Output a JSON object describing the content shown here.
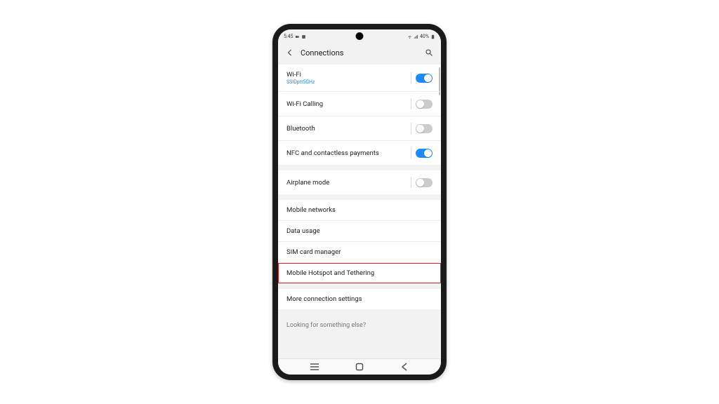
{
  "statusbar": {
    "time": "5:45",
    "battery": "40%"
  },
  "header": {
    "title": "Connections"
  },
  "groups": [
    {
      "items": [
        {
          "label": "Wi-Fi",
          "sub": "SSIDptt5GHz",
          "toggle": true,
          "on": true,
          "name": "row-wifi",
          "tname": "toggle-wifi"
        },
        {
          "label": "Wi-Fi Calling",
          "toggle": true,
          "on": false,
          "name": "row-wifi-calling",
          "tname": "toggle-wifi-calling"
        },
        {
          "label": "Bluetooth",
          "toggle": true,
          "on": false,
          "name": "row-bluetooth",
          "tname": "toggle-bluetooth"
        },
        {
          "label": "NFC and contactless payments",
          "toggle": true,
          "on": true,
          "name": "row-nfc",
          "tname": "toggle-nfc"
        }
      ]
    },
    {
      "items": [
        {
          "label": "Airplane mode",
          "toggle": true,
          "on": false,
          "name": "row-airplane",
          "tname": "toggle-airplane"
        }
      ]
    },
    {
      "items": [
        {
          "label": "Mobile networks",
          "name": "row-mobile-networks"
        },
        {
          "label": "Data usage",
          "name": "row-data-usage"
        },
        {
          "label": "SIM card manager",
          "name": "row-sim-manager"
        },
        {
          "label": "Mobile Hotspot and Tethering",
          "highlight": true,
          "name": "row-hotspot-tethering"
        }
      ]
    },
    {
      "items": [
        {
          "label": "More connection settings",
          "name": "row-more-connection-settings"
        }
      ]
    }
  ],
  "footer": {
    "prompt": "Looking for something else?"
  }
}
